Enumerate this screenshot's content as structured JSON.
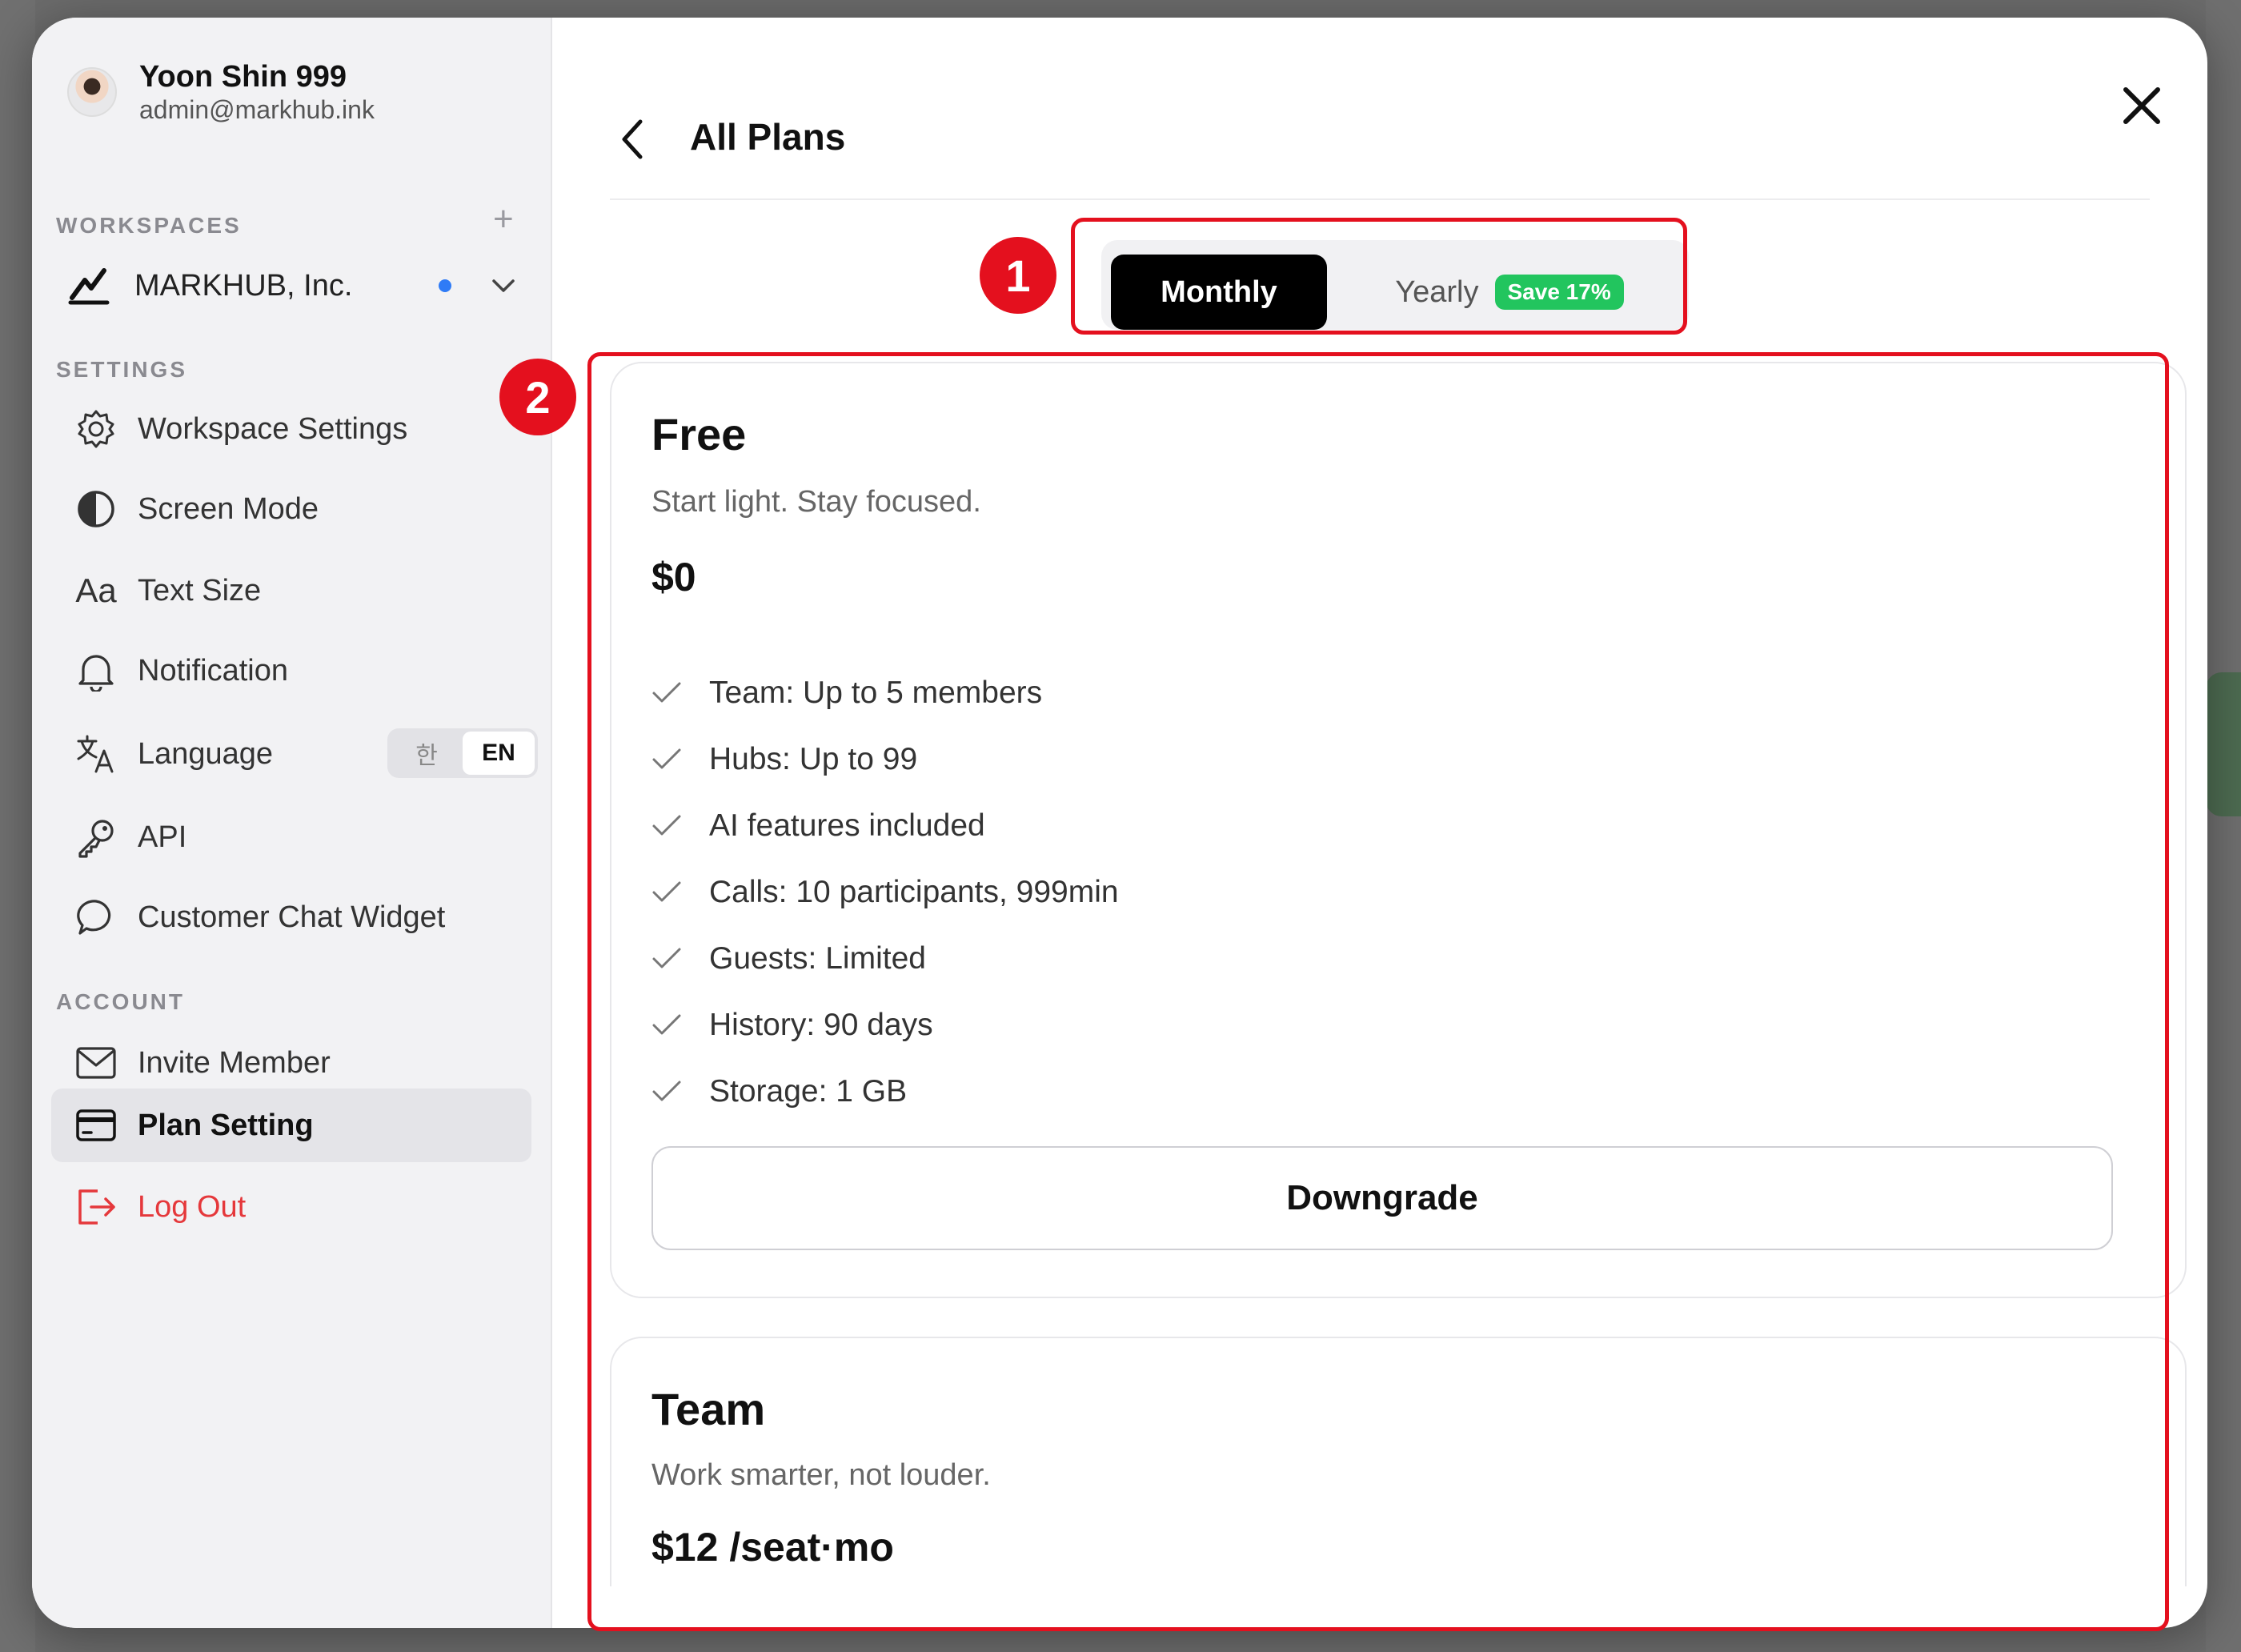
{
  "profile": {
    "name": "Yoon Shin 999",
    "email": "admin@markhub.ink"
  },
  "workspaces": {
    "label": "WORKSPACES",
    "current": "MARKHUB, Inc."
  },
  "settings": {
    "label": "SETTINGS",
    "items": [
      {
        "label": "Workspace Settings",
        "icon": "gear-icon"
      },
      {
        "label": "Screen Mode",
        "icon": "contrast-icon"
      },
      {
        "label": "Text Size",
        "icon": "text-size-icon"
      },
      {
        "label": "Notification",
        "icon": "bell-icon"
      },
      {
        "label": "Language",
        "icon": "translate-icon"
      },
      {
        "label": "API",
        "icon": "key-icon"
      },
      {
        "label": "Customer Chat Widget",
        "icon": "chat-bubble-icon"
      }
    ],
    "language_options": [
      "한",
      "EN"
    ],
    "language_selected": "EN"
  },
  "account": {
    "label": "ACCOUNT",
    "items": [
      {
        "label": "Invite Member",
        "icon": "mail-icon"
      },
      {
        "label": "Plan Setting",
        "icon": "credit-card-icon"
      },
      {
        "label": "Log Out",
        "icon": "logout-icon"
      }
    ]
  },
  "header": {
    "title": "All Plans"
  },
  "billing": {
    "monthly_label": "Monthly",
    "yearly_label": "Yearly",
    "yearly_badge": "Save 17%",
    "selected": "Monthly"
  },
  "plans": [
    {
      "name": "Free",
      "tagline": "Start light. Stay focused.",
      "price": "$0",
      "features": [
        "Team: Up to 5 members",
        "Hubs: Up to 99",
        "AI features included",
        "Calls: 10 participants, 999min",
        "Guests: Limited",
        "History: 90 days",
        "Storage: 1 GB"
      ],
      "action": "Downgrade"
    },
    {
      "name": "Team",
      "tagline": "Work smarter, not louder.",
      "price": "$12 /seat·mo"
    }
  ],
  "annotations": {
    "one": "1",
    "two": "2",
    "color": "#e4101e"
  },
  "colors": {
    "accent_dot": "#2f7bf6",
    "save_badge": "#22c55e",
    "logout": "#e5383b"
  }
}
